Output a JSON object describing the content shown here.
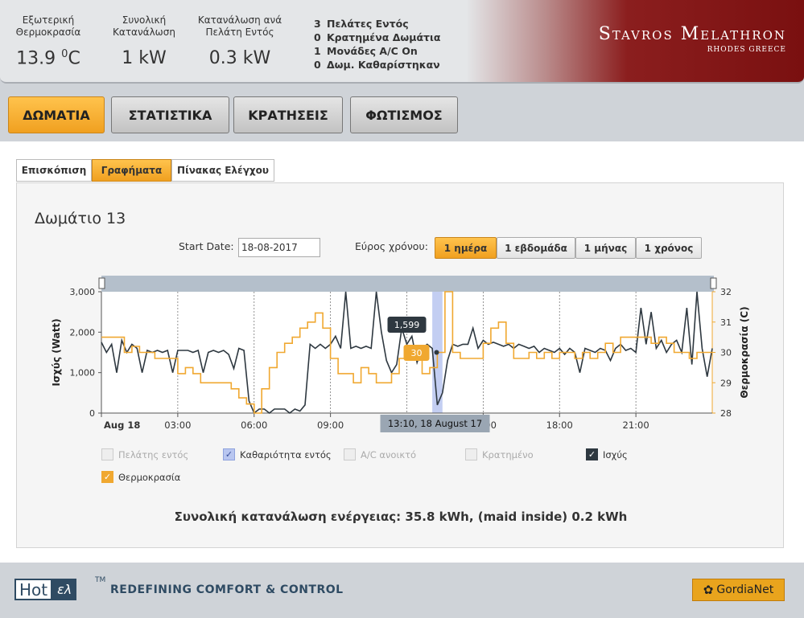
{
  "header": {
    "stats": [
      {
        "label_line1": "Εξωτερική",
        "label_line2": "Θερμοκρασία",
        "value": "13.9",
        "unit_sup": "0",
        "unit": "C"
      },
      {
        "label_line1": "Συνολική",
        "label_line2": "Κατανάλωση",
        "value": "1 kW"
      },
      {
        "label_line1": "Κατανάλωση ανά",
        "label_line2": "Πελάτη Εντός",
        "value": "0.3 kW"
      }
    ],
    "occupancy": [
      {
        "count": "3",
        "label": "Πελάτες Εντός"
      },
      {
        "count": "0",
        "label": "Κρατημένα Δωμάτια"
      },
      {
        "count": "1",
        "label": "Μονάδες A/C On"
      },
      {
        "count": "0",
        "label": "Δωμ. Καθαρίστηκαν"
      }
    ],
    "brand_name": "Stavros Melathron",
    "brand_sub": "RHODES GREECE"
  },
  "main_tabs": [
    "ΔΩΜΑΤΙΑ",
    "ΣΤΑΤΙΣΤΙΚΑ",
    "ΚΡΑΤΗΣΕΙΣ",
    "ΦΩΤΙΣΜΟΣ"
  ],
  "main_tab_active": "ΔΩΜΑΤΙΑ",
  "sub_tabs": [
    "Επισκόπιση",
    "Γραφήματα",
    "Πίνακας Ελέγχου"
  ],
  "sub_tab_active": "Γραφήματα",
  "panel": {
    "room_title": "Δωμάτιο 13",
    "start_label": "Start Date:",
    "start_value": "18-08-2017",
    "range_label": "Εύρος χρόνου:",
    "range_buttons": [
      "1 ημέρα",
      "1 εβδομάδα",
      "1 μήνας",
      "1 χρόνος"
    ],
    "range_active": "1 ημέρα",
    "summary": "Συνολική κατανάλωση ενέργειας: 35.8 kWh, (maid inside) 0.2 kWh"
  },
  "legend": [
    {
      "label": "Πελάτης εντός",
      "checked": false,
      "enabled": false
    },
    {
      "label": "Καθαριότητα εντός",
      "checked": true,
      "enabled": true,
      "color": "#b8c6f0"
    },
    {
      "label": "A/C ανοικτό",
      "checked": false,
      "enabled": false
    },
    {
      "label": "Κρατημένο",
      "checked": false,
      "enabled": false
    },
    {
      "label": "Ισχύς",
      "checked": true,
      "enabled": true,
      "color": "#2e3840"
    },
    {
      "label": "Θερμοκρασία",
      "checked": true,
      "enabled": true,
      "color": "#f0a830"
    }
  ],
  "chart_data": {
    "type": "line",
    "ylabel": "Ισχύς (Watt)",
    "y2label": "Θερμοκρασία (C)",
    "ylim": [
      0,
      3000
    ],
    "y2lim": [
      28,
      32
    ],
    "yticks": [
      "0",
      "1,000",
      "2,000",
      "3,000"
    ],
    "y2ticks": [
      "28",
      "29",
      "30",
      "31",
      "32"
    ],
    "xlim_hours": [
      0,
      24
    ],
    "xticks": [
      {
        "h": 0,
        "label": "Aug 18"
      },
      {
        "h": 3,
        "label": "03:00"
      },
      {
        "h": 6,
        "label": "06:00"
      },
      {
        "h": 9,
        "label": "09:00"
      },
      {
        "h": 15,
        "label": "15:00"
      },
      {
        "h": 18,
        "label": "18:00"
      },
      {
        "h": 21,
        "label": "21:00"
      }
    ],
    "maid_band_hours": [
      13.0,
      13.4
    ],
    "tooltip": {
      "time": "13:10, 18 August 17",
      "power": "1,599",
      "temperature": "30",
      "h": 13.17
    },
    "series": [
      {
        "name": "Ισχύς",
        "color": "#2e3840",
        "x": [
          0,
          0.2,
          0.4,
          0.6,
          0.8,
          1.0,
          1.2,
          1.4,
          1.6,
          1.8,
          2.0,
          2.2,
          2.4,
          2.6,
          2.8,
          3.0,
          3.2,
          3.4,
          3.6,
          3.8,
          4.0,
          4.2,
          4.4,
          4.6,
          4.8,
          5.0,
          5.2,
          5.4,
          5.6,
          5.8,
          6.0,
          6.2,
          6.4,
          6.6,
          6.8,
          7.0,
          7.2,
          7.4,
          7.6,
          7.8,
          8.0,
          8.2,
          8.4,
          8.6,
          8.8,
          9.0,
          9.2,
          9.4,
          9.6,
          9.8,
          10.0,
          10.2,
          10.4,
          10.6,
          10.8,
          11.0,
          11.2,
          11.4,
          11.6,
          11.8,
          12.0,
          12.2,
          12.4,
          12.6,
          12.8,
          13.0,
          13.2,
          13.4,
          13.6,
          13.8,
          14.0,
          14.2,
          14.4,
          14.6,
          14.8,
          15.0,
          15.2,
          15.4,
          15.6,
          15.8,
          16.0,
          16.2,
          16.4,
          16.6,
          16.8,
          17.0,
          17.2,
          17.4,
          17.6,
          17.8,
          18.0,
          18.2,
          18.4,
          18.6,
          18.8,
          19.0,
          19.2,
          19.4,
          19.6,
          19.8,
          20.0,
          20.2,
          20.4,
          20.6,
          20.8,
          21.0,
          21.2,
          21.4,
          21.6,
          21.8,
          22.0,
          22.2,
          22.4,
          22.6,
          22.8,
          23.0,
          23.2,
          23.4,
          23.6,
          23.8,
          24.0
        ],
        "values": [
          1750,
          1500,
          1700,
          1000,
          1800,
          1500,
          1700,
          1600,
          1000,
          1550,
          1500,
          1550,
          1500,
          1550,
          1000,
          1550,
          1550,
          1550,
          1500,
          1550,
          1000,
          1500,
          1550,
          1500,
          1550,
          1450,
          1100,
          1600,
          1550,
          300,
          0,
          100,
          100,
          0,
          100,
          100,
          100,
          0,
          100,
          50,
          200,
          1700,
          1600,
          1700,
          1600,
          1700,
          1900,
          1600,
          3000,
          1600,
          1650,
          1600,
          1650,
          1600,
          3000,
          2000,
          1300,
          1000,
          1200,
          2100,
          1700,
          1900,
          1250,
          1600,
          1700,
          1600,
          200,
          500,
          1300,
          1700,
          1650,
          1700,
          1700,
          2100,
          1600,
          1800,
          1700,
          1750,
          1700,
          1650,
          1700,
          1600,
          1700,
          1650,
          1600,
          1650,
          1500,
          1600,
          1550,
          1500,
          1600,
          1450,
          1600,
          1500,
          1000,
          1600,
          1550,
          1500,
          1600,
          1550,
          1300,
          1600,
          1700,
          1550,
          1600,
          1500,
          2600,
          1700,
          2500,
          1600,
          1800,
          1500,
          1700,
          1800,
          1500,
          2600,
          1200,
          3000,
          1600,
          900,
          1600
        ]
      },
      {
        "name": "Θερμοκρασία",
        "color": "#f0a830",
        "x": [
          0,
          0.3,
          0.6,
          0.9,
          1.2,
          1.5,
          1.8,
          2.1,
          2.4,
          2.7,
          3.0,
          3.3,
          3.6,
          3.9,
          4.2,
          4.5,
          4.8,
          5.1,
          5.4,
          5.7,
          6.0,
          6.3,
          6.6,
          6.9,
          7.2,
          7.5,
          7.8,
          8.1,
          8.4,
          8.7,
          9.0,
          9.3,
          9.6,
          9.9,
          10.2,
          10.5,
          10.8,
          11.1,
          11.4,
          11.7,
          12.0,
          12.3,
          12.6,
          12.9,
          13.2,
          13.5,
          13.8,
          14.1,
          14.4,
          14.7,
          15.0,
          15.3,
          15.6,
          15.9,
          16.2,
          16.5,
          16.8,
          17.1,
          17.4,
          17.7,
          18.0,
          18.3,
          18.6,
          18.9,
          19.2,
          19.5,
          19.8,
          20.1,
          20.4,
          20.7,
          21.0,
          21.3,
          21.6,
          21.9,
          22.2,
          22.5,
          22.8,
          23.1,
          23.4,
          23.7,
          24.0
        ],
        "values": [
          30.5,
          30.5,
          30.5,
          30.0,
          30.2,
          30.0,
          30.0,
          29.8,
          29.8,
          29.8,
          29.3,
          29.5,
          29.3,
          29.0,
          29.0,
          29.0,
          29.0,
          28.8,
          28.5,
          28.3,
          28.0,
          28.8,
          29.5,
          30.0,
          30.3,
          30.5,
          30.8,
          31.0,
          31.3,
          30.8,
          29.8,
          29.3,
          29.3,
          29.0,
          29.5,
          29.3,
          29.0,
          29.0,
          29.3,
          29.8,
          30.0,
          29.8,
          29.3,
          29.5,
          30.0,
          32.0,
          30.0,
          29.8,
          29.8,
          29.8,
          30.3,
          30.8,
          31.0,
          30.3,
          29.8,
          29.8,
          30.0,
          29.8,
          30.0,
          29.8,
          30.0,
          30.0,
          29.8,
          30.0,
          29.8,
          30.0,
          30.3,
          30.0,
          30.5,
          30.5,
          30.5,
          30.5,
          30.3,
          30.5,
          30.3,
          30.0,
          30.0,
          29.8,
          30.0,
          30.0,
          30.0
        ]
      }
    ]
  }
}
